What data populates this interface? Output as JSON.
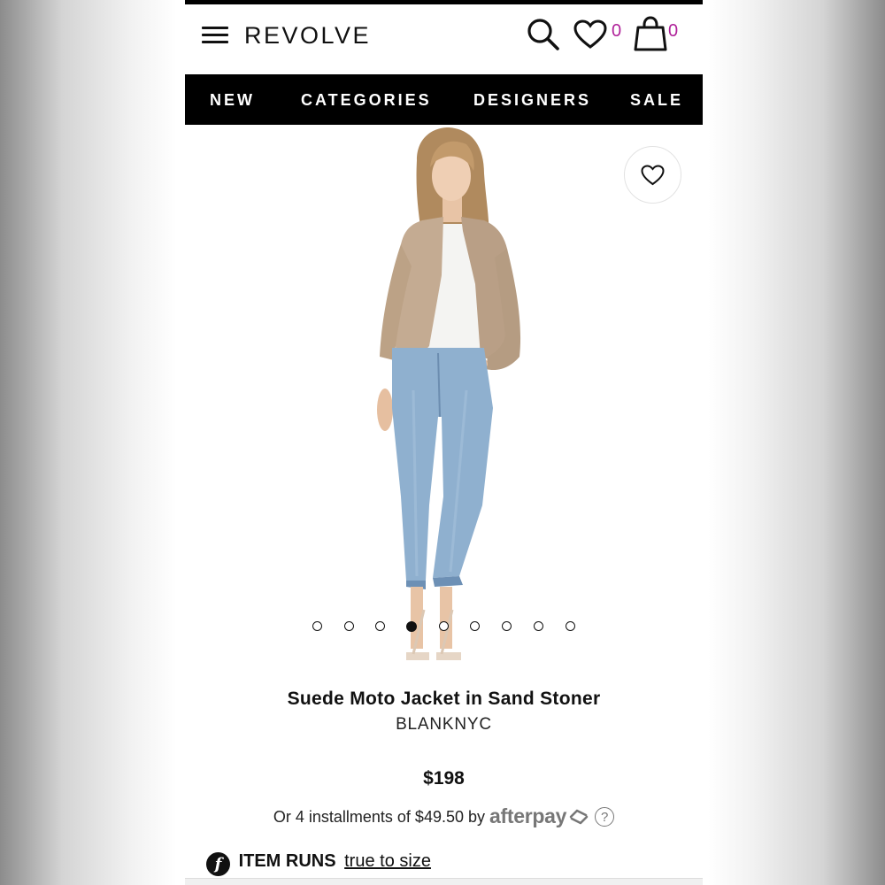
{
  "header": {
    "logo": "REVOLVE",
    "wishlist_count": "0",
    "bag_count": "0"
  },
  "nav": {
    "items": [
      {
        "label": "NEW"
      },
      {
        "label": "CATEGORIES"
      },
      {
        "label": "DESIGNERS"
      },
      {
        "label": "SALE"
      }
    ]
  },
  "gallery": {
    "image": "model wearing sand suede moto jacket, white tee, light blue jeans",
    "dot_count": 9,
    "active_index": 3
  },
  "product": {
    "title": "Suede Moto Jacket in Sand Stoner",
    "designer": "BLANKNYC",
    "price": "$198"
  },
  "afterpay": {
    "text": "Or 4 installments of $49.50 by",
    "brand": "afterpay",
    "help": "?"
  },
  "fit": {
    "icon_letter": "f",
    "label": "ITEM RUNS",
    "value": "true to size"
  },
  "colors": {
    "nav_bg": "#000000",
    "count": "#b0229a",
    "jacket": "#c4ab92",
    "denim": "#8fb0cf"
  },
  "icons": [
    "hamburger-icon",
    "search-icon",
    "heart-icon",
    "shopping-bag-icon",
    "afterpay-arrows-icon",
    "help-icon",
    "fit-icon"
  ]
}
